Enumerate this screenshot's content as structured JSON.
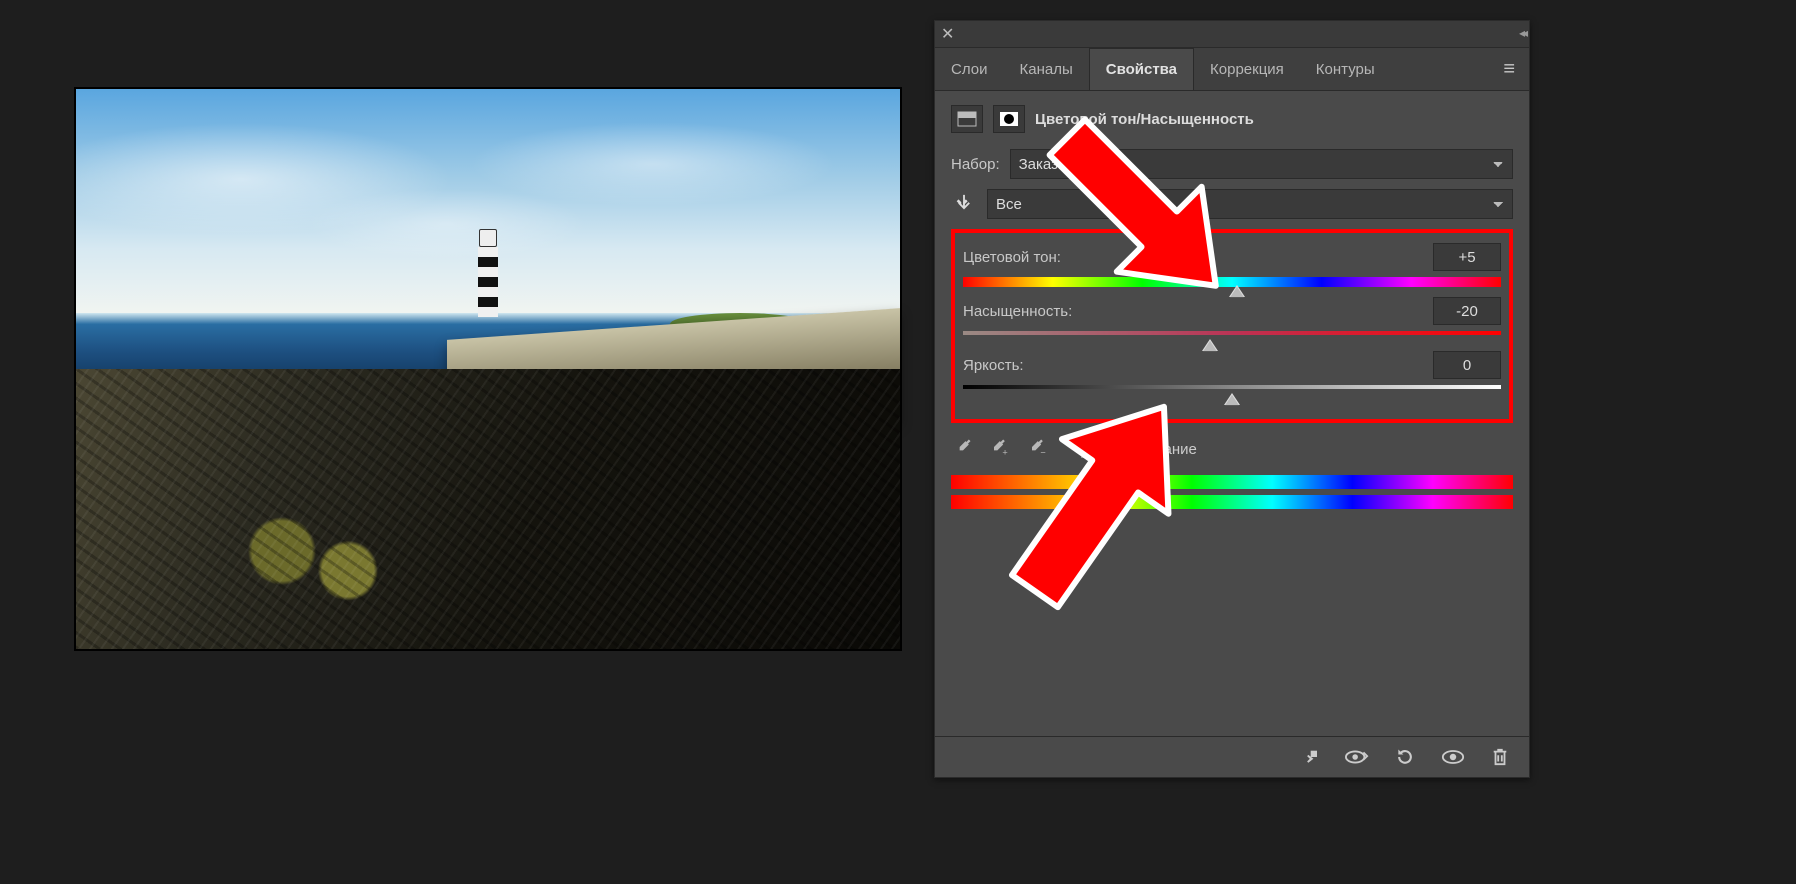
{
  "tabs": {
    "layers": "Слои",
    "channels": "Каналы",
    "properties": "Свойства",
    "adjustments": "Коррекция",
    "paths": "Контуры"
  },
  "header": {
    "title": "Цветовой тон/Насыщенность"
  },
  "preset": {
    "label": "Набор:",
    "value": "Заказная"
  },
  "range": {
    "value": "Все"
  },
  "sliders": {
    "hue": {
      "label": "Цветовой тон:",
      "value": "+5",
      "pos": 51
    },
    "sat": {
      "label": "Насыщенность:",
      "value": "-20",
      "pos": 46
    },
    "lgt": {
      "label": "Яркость:",
      "value": "0",
      "pos": 50
    }
  },
  "colorize": {
    "label": "Тонирование"
  }
}
